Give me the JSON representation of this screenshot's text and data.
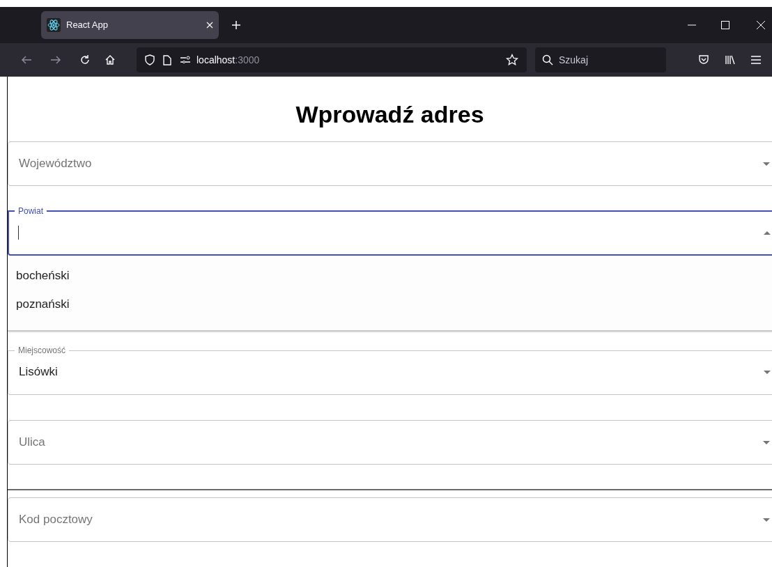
{
  "browser": {
    "tab": {
      "title": "React App",
      "selected": true
    },
    "url": {
      "host": "localhost",
      "port": ":3000"
    },
    "search": {
      "placeholder": "Szukaj"
    }
  },
  "page": {
    "title": "Wprowadź adres",
    "fields": [
      {
        "label": "Województwo",
        "focused": false,
        "expanded": false
      },
      {
        "label": "Powiat",
        "focused": true,
        "expanded": true,
        "options": [
          "bocheński",
          "poznański"
        ]
      },
      {
        "label": "Miejscowość",
        "value": "Lisówki",
        "focused": false,
        "expanded": false
      },
      {
        "label": "Ulica",
        "focused": false,
        "expanded": false
      },
      {
        "label": "Kod pocztowy",
        "focused": false,
        "expanded": false,
        "divider_above": true
      }
    ]
  }
}
